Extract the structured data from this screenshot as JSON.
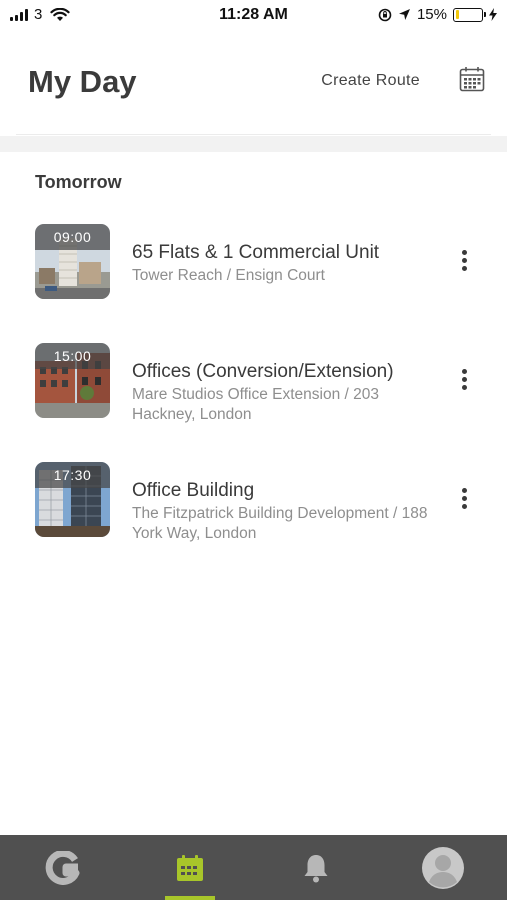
{
  "status_bar": {
    "carrier": "3",
    "time": "11:28 AM",
    "battery_text": "15%",
    "battery_level": 0.15
  },
  "header": {
    "title": "My Day",
    "create_route_label": "Create Route",
    "calendar_icon": "calendar-icon"
  },
  "section": {
    "title": "Tomorrow"
  },
  "appointments": [
    {
      "time": "09:00",
      "title": "65 Flats & 1 Commercial Unit",
      "subtitle": "Tower Reach / Ensign Court"
    },
    {
      "time": "15:00",
      "title": "Offices (Conversion/Extension)",
      "subtitle": "Mare Studios Office Extension / 203 Hackney, London"
    },
    {
      "time": "17:30",
      "title": "Office Building",
      "subtitle": "The Fitzpatrick Building Development / 188 York Way, London"
    }
  ],
  "tab_bar": {
    "tabs": [
      "logo-icon",
      "calendar-icon",
      "bell-icon",
      "profile-icon"
    ],
    "active_tab": "calendar",
    "accent": "#a8c62a",
    "background": "#505050"
  }
}
